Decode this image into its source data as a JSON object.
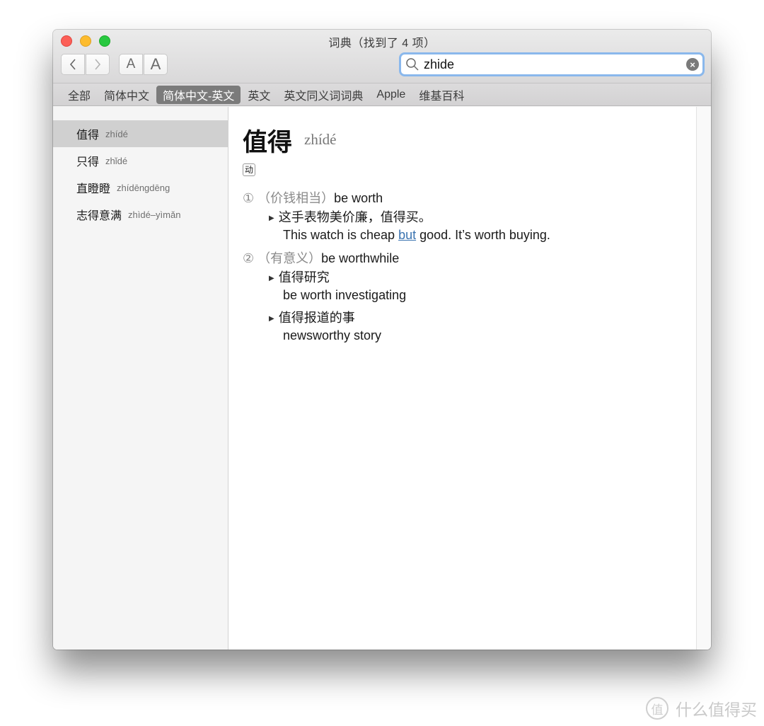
{
  "window": {
    "title": "词典（找到了 4 项）"
  },
  "toolbar": {
    "back_icon": "‹",
    "forward_icon": "›",
    "font_smaller_label": "A",
    "font_larger_label": "A"
  },
  "search": {
    "value": "zhide",
    "placeholder": "",
    "clear_icon": "×"
  },
  "scopes": [
    {
      "label": "全部",
      "active": false
    },
    {
      "label": "简体中文",
      "active": false
    },
    {
      "label": "简体中文-英文",
      "active": true
    },
    {
      "label": "英文",
      "active": false
    },
    {
      "label": "英文同义词词典",
      "active": false
    },
    {
      "label": "Apple",
      "active": false
    },
    {
      "label": "维基百科",
      "active": false
    }
  ],
  "results": [
    {
      "word": "值得",
      "pinyin": "zhídé",
      "selected": true
    },
    {
      "word": "只得",
      "pinyin": "zhǐdé",
      "selected": false
    },
    {
      "word": "直瞪瞪",
      "pinyin": "zhídēngdēng",
      "selected": false
    },
    {
      "word": "志得意满",
      "pinyin": "zhìdé–yìmǎn",
      "selected": false
    }
  ],
  "entry": {
    "headword": "值得",
    "pinyin": "zhídé",
    "part_of_speech": "动",
    "senses": [
      {
        "number": "①",
        "note": "（价钱相当）",
        "gloss": "be worth",
        "examples": [
          {
            "zh": "这手表物美价廉，值得买。",
            "en_before": "This watch is cheap ",
            "en_link": "but",
            "en_after": " good. It’s worth buying."
          }
        ]
      },
      {
        "number": "②",
        "note": "（有意义）",
        "gloss": "be worthwhile",
        "examples": [
          {
            "zh": "值得研究",
            "en": "be worth investigating"
          },
          {
            "zh": "值得报道的事",
            "en": "newsworthy story"
          }
        ]
      }
    ]
  },
  "watermark": {
    "badge": "值",
    "text": "什么值得买"
  },
  "colors": {
    "search_focus_ring": "#8ab8ec",
    "active_scope_bg": "#7b7b7b",
    "selected_row_bg": "#d0d0d0",
    "link": "#3a73b0"
  }
}
